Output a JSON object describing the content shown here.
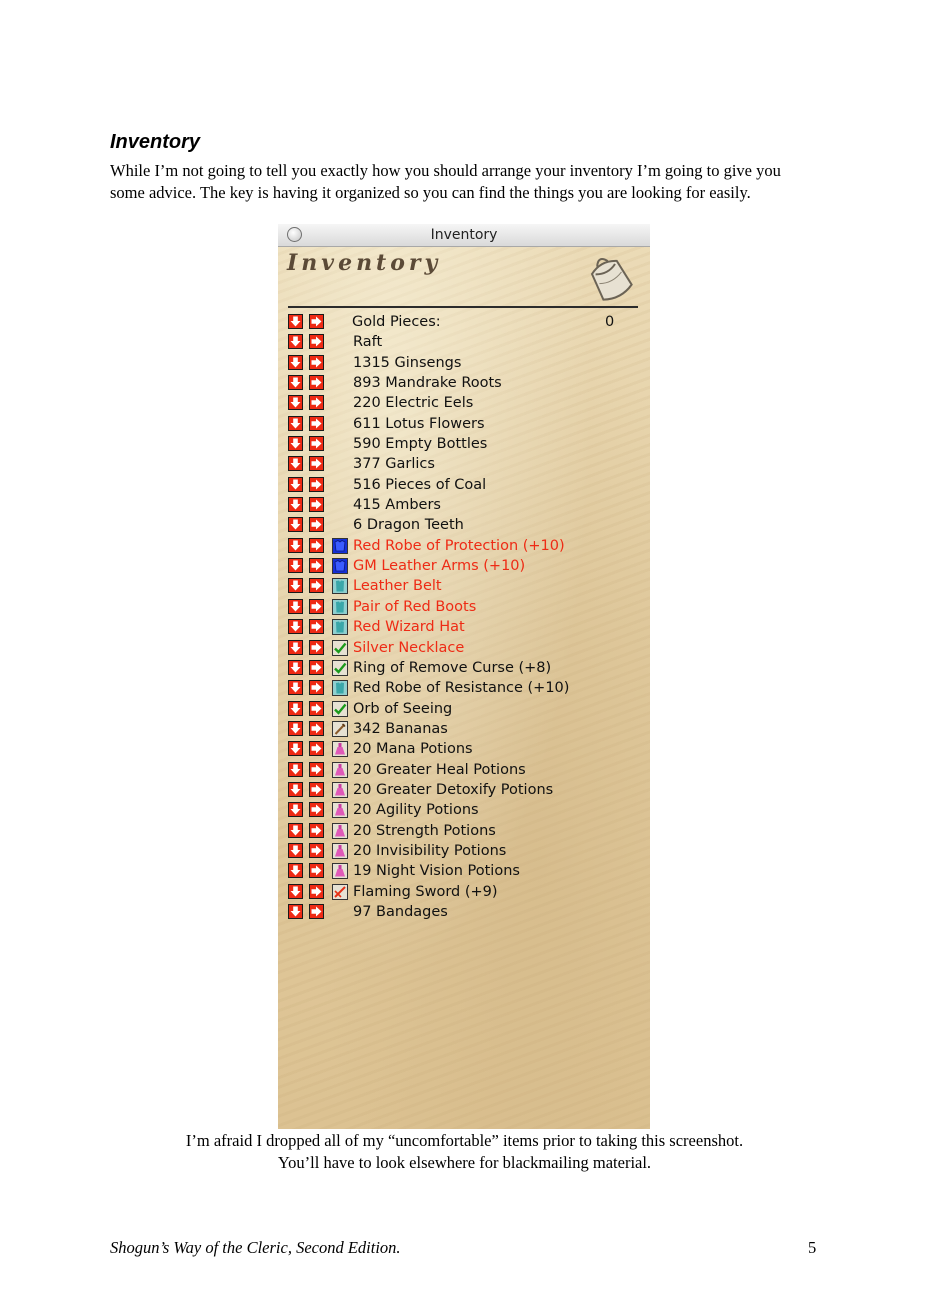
{
  "heading": "Inventory",
  "intro": "While I’m not going to tell you exactly how you should arrange your inventory I’m going to give you some advice. The key is having it organized so you can find the things you are looking for easily.",
  "window": {
    "title": "Inventory",
    "panel_heading": "Inventory",
    "icons": {
      "close": "close-button",
      "bag": "bag-icon",
      "drop": "drop-arrow-icon",
      "give": "give-arrow-icon"
    },
    "colors": {
      "equipped_text": "#ee2b15",
      "normal_text": "#111111",
      "arrow_button": "#ee2a14",
      "parchment": "#e2cca0"
    },
    "gold": {
      "label": "Gold Pieces:",
      "value": "0"
    },
    "items": [
      {
        "name": "Raft",
        "icon": "",
        "equipped": false
      },
      {
        "name": "1315 Ginsengs",
        "icon": "",
        "equipped": false
      },
      {
        "name": "893 Mandrake Roots",
        "icon": "",
        "equipped": false
      },
      {
        "name": "220 Electric Eels",
        "icon": "",
        "equipped": false
      },
      {
        "name": "611 Lotus Flowers",
        "icon": "",
        "equipped": false
      },
      {
        "name": "590 Empty Bottles",
        "icon": "",
        "equipped": false
      },
      {
        "name": "377 Garlics",
        "icon": "",
        "equipped": false
      },
      {
        "name": "516 Pieces of Coal",
        "icon": "",
        "equipped": false
      },
      {
        "name": "415 Ambers",
        "icon": "",
        "equipped": false
      },
      {
        "name": "6 Dragon Teeth",
        "icon": "",
        "equipped": false
      },
      {
        "name": "Red Robe of Protection (+10)",
        "icon": "armor-icon",
        "equipped": true
      },
      {
        "name": "GM Leather Arms (+10)",
        "icon": "armor-icon",
        "equipped": true
      },
      {
        "name": "Leather Belt",
        "icon": "clothing-icon",
        "equipped": true
      },
      {
        "name": "Pair of Red Boots",
        "icon": "clothing-icon",
        "equipped": true
      },
      {
        "name": "Red Wizard Hat",
        "icon": "clothing-icon",
        "equipped": true
      },
      {
        "name": "Silver Necklace",
        "icon": "checkmark-icon",
        "equipped": true
      },
      {
        "name": "Ring of Remove Curse (+8)",
        "icon": "checkmark-icon",
        "equipped": false
      },
      {
        "name": "Red Robe of Resistance (+10)",
        "icon": "clothing-icon",
        "equipped": false
      },
      {
        "name": "Orb of Seeing",
        "icon": "checkmark-icon",
        "equipped": false
      },
      {
        "name": "342 Bananas",
        "icon": "food-icon",
        "equipped": false
      },
      {
        "name": "20 Mana Potions",
        "icon": "potion-icon",
        "equipped": false
      },
      {
        "name": "20 Greater Heal Potions",
        "icon": "potion-icon",
        "equipped": false
      },
      {
        "name": "20 Greater Detoxify Potions",
        "icon": "potion-icon",
        "equipped": false
      },
      {
        "name": "20 Agility Potions",
        "icon": "potion-icon",
        "equipped": false
      },
      {
        "name": "20 Strength Potions",
        "icon": "potion-icon",
        "equipped": false
      },
      {
        "name": "20 Invisibility Potions",
        "icon": "potion-icon",
        "equipped": false
      },
      {
        "name": "19 Night Vision Potions",
        "icon": "potion-icon",
        "equipped": false
      },
      {
        "name": "Flaming Sword (+9)",
        "icon": "weapon-icon",
        "equipped": false
      },
      {
        "name": "97 Bandages",
        "icon": "",
        "equipped": false
      }
    ]
  },
  "caption": {
    "line1": "I’m afraid I dropped all of my “uncomfortable” items prior to taking this screenshot.",
    "line2": "You’ll have to look elsewhere for blackmailing material."
  },
  "footer": {
    "title": "Shogun’s Way of the Cleric, Second Edition.",
    "page": "5"
  }
}
